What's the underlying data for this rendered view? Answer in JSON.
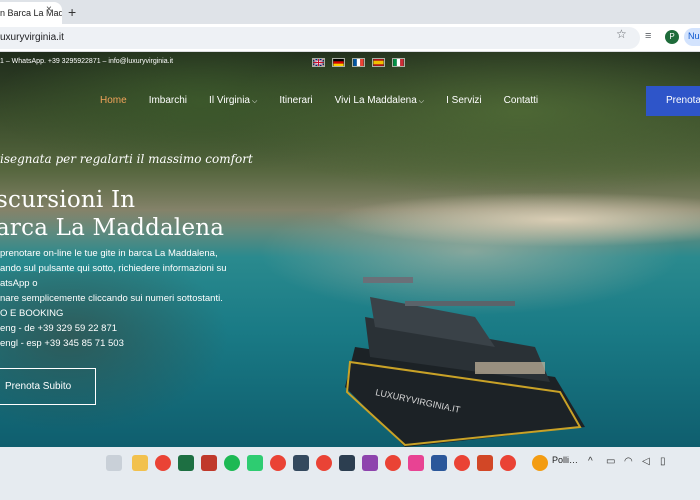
{
  "browser": {
    "tab_title": "n Barca La Maddalena",
    "tab_close": "×",
    "new_tab": "+",
    "url": "uxuryvirginia.it",
    "profile_initial": "P",
    "profile_button": "Nu"
  },
  "site": {
    "top_info": "1 – WhatsApp. +39 3295922871 – info@luxuryvirginia.it",
    "flags": [
      {
        "name": "uk-flag",
        "colors": [
          "#012169",
          "#ffffff",
          "#c8102e"
        ]
      },
      {
        "name": "germany-flag",
        "colors": [
          "#000000",
          "#dd0000",
          "#ffce00"
        ]
      },
      {
        "name": "france-flag",
        "colors": [
          "#0055a4",
          "#ffffff",
          "#ef4135"
        ]
      },
      {
        "name": "spain-flag",
        "colors": [
          "#aa151b",
          "#f1bf00",
          "#aa151b"
        ]
      },
      {
        "name": "italy-flag",
        "colors": [
          "#009246",
          "#ffffff",
          "#ce2b37"
        ]
      }
    ],
    "nav": [
      {
        "label": "Home",
        "active": true,
        "dropdown": false
      },
      {
        "label": "Imbarchi",
        "active": false,
        "dropdown": false
      },
      {
        "label": "Il Virginia",
        "active": false,
        "dropdown": true
      },
      {
        "label": "Itinerari",
        "active": false,
        "dropdown": false
      },
      {
        "label": "Vivi La Maddalena",
        "active": false,
        "dropdown": true
      },
      {
        "label": "I Servizi",
        "active": false,
        "dropdown": false
      },
      {
        "label": "Contatti",
        "active": false,
        "dropdown": false
      }
    ],
    "cta": "Prenota",
    "tagline": "isegnata per regalarti il massimo comfort",
    "title_line1": "scursioni In",
    "title_line2": "arca La Maddalena",
    "body": [
      "prenotare on-line le tue gite in barca La Maddalena,",
      "ando sul pulsante qui sotto, richiedere informazioni su",
      "atsApp o",
      "nare semplicemente cliccando sui numeri sottostanti.",
      "O E BOOKING",
      "eng - de +39 329 59 22 871",
      "engl - esp +39 345 85 71 503"
    ],
    "book_button": "Prenota Subito",
    "boat_name": "LUXURYVIRGINIA.IT"
  },
  "taskbar": {
    "weather_label": "Polli…",
    "colors": {
      "accent": "#2e55c9",
      "nav_active": "#f0a35a"
    }
  }
}
